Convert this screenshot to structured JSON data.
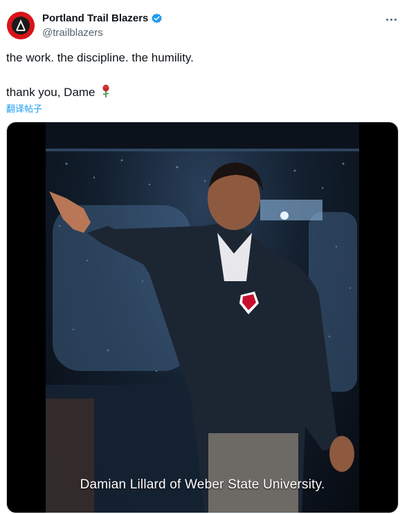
{
  "account": {
    "display_name": "Portland Trail Blazers",
    "handle": "@trailblazers",
    "verified_icon": "verified-badge-icon",
    "brand_color": "#d7141a"
  },
  "tweet": {
    "line1": "the work. the discipline. the humility.",
    "line2": "thank you, Dame",
    "emoji_icon": "rose-icon",
    "translate_label": "翻译帖子"
  },
  "media": {
    "type": "video",
    "caption": "Damian Lillard of Weber State University."
  },
  "colors": {
    "text": "#0f1419",
    "secondary": "#536471",
    "link": "#1d9bf0",
    "verified": "#1d9bf0"
  }
}
